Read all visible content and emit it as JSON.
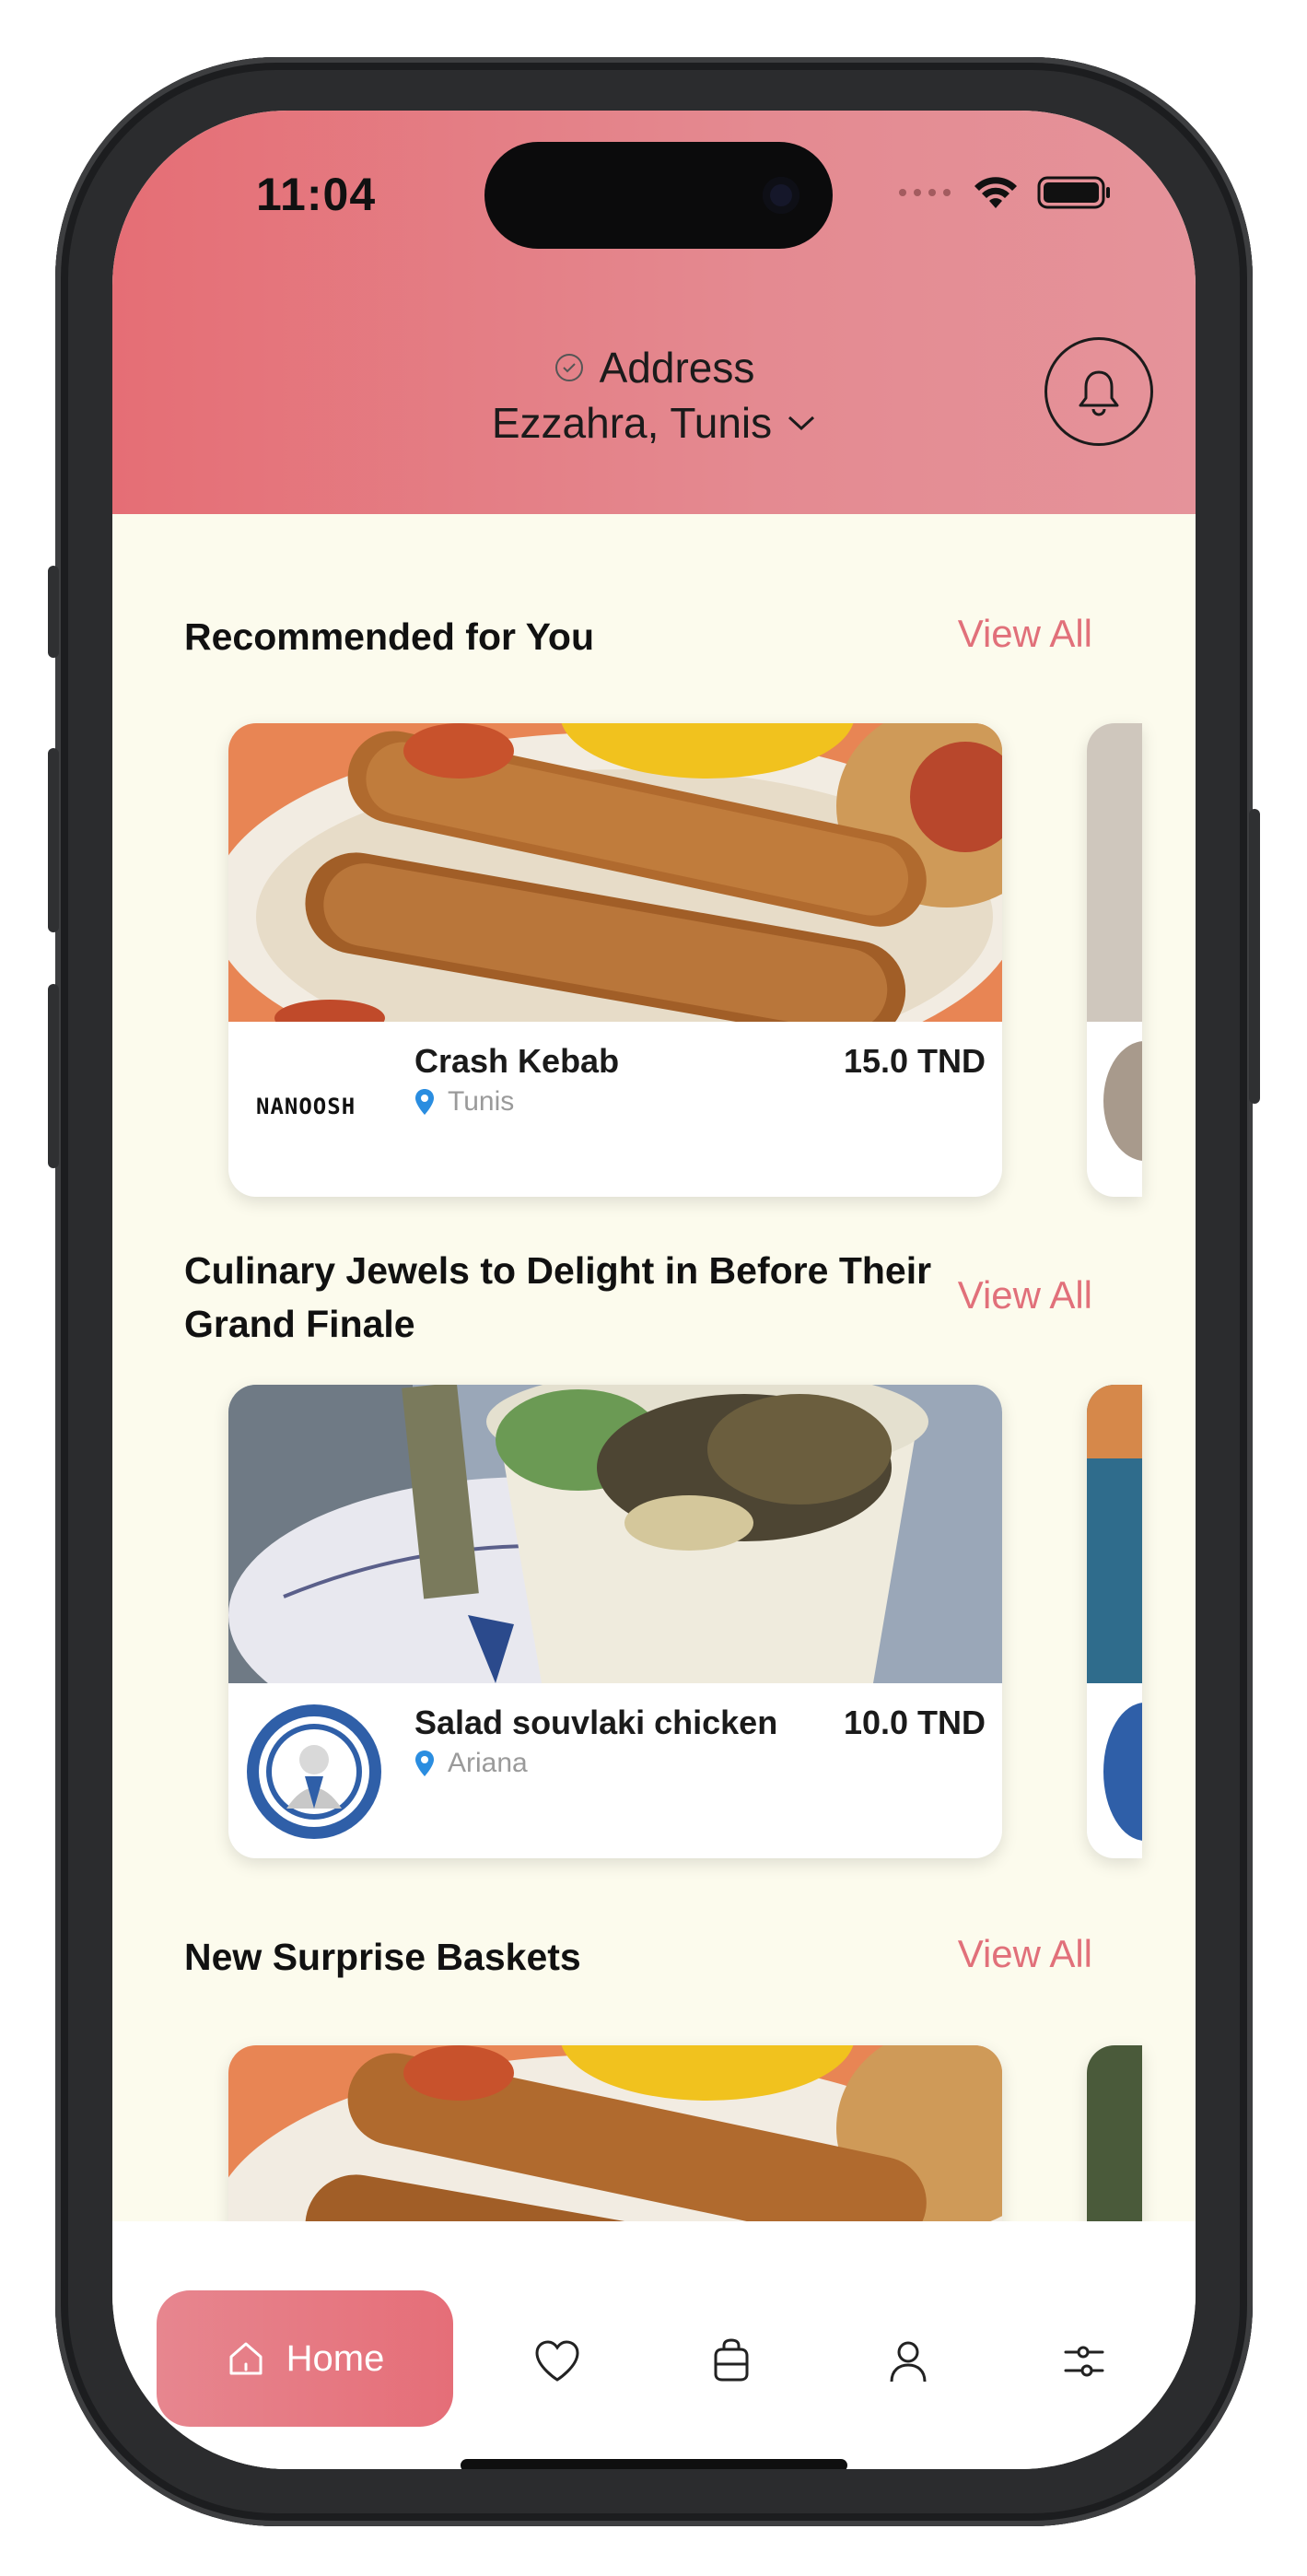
{
  "status_bar": {
    "time": "11:04"
  },
  "header": {
    "address_label": "Address",
    "address_value": "Ezzahra, Tunis",
    "notification_icon": "bell-icon"
  },
  "sections": [
    {
      "title": "Recommended for You",
      "view_all": "View All",
      "card": {
        "name": "Crash Kebab",
        "price": "15.0 TND",
        "location": "Tunis",
        "logo_text": "NANOOSH"
      }
    },
    {
      "title": "Culinary Jewels to Delight in Before Their Grand Finale",
      "view_all": "View All",
      "card": {
        "name": "Salad souvlaki chicken",
        "price": "10.0 TND",
        "location": "Ariana"
      }
    },
    {
      "title": "New Surprise Baskets",
      "view_all": "View All"
    }
  ],
  "bottom_nav": {
    "home_label": "Home",
    "items": [
      "home-icon",
      "heart-icon",
      "bag-icon",
      "user-icon",
      "sliders-icon"
    ]
  },
  "colors": {
    "accent": "#e1707a",
    "header": "#e56e75",
    "background": "#fcfbed"
  }
}
